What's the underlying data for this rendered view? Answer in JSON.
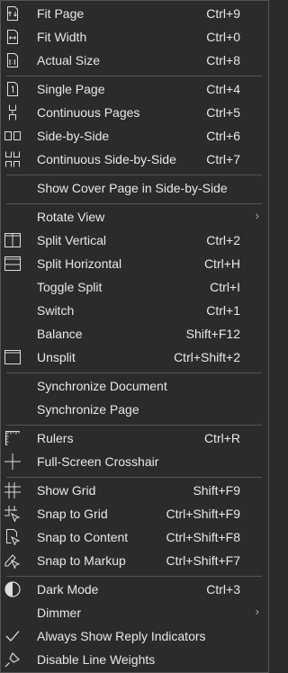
{
  "menu": {
    "fit_page": {
      "label": "Fit Page",
      "shortcut": "Ctrl+9"
    },
    "fit_width": {
      "label": "Fit Width",
      "shortcut": "Ctrl+0"
    },
    "actual_size": {
      "label": "Actual Size",
      "shortcut": "Ctrl+8"
    },
    "single_page": {
      "label": "Single Page",
      "shortcut": "Ctrl+4"
    },
    "continuous_pages": {
      "label": "Continuous Pages",
      "shortcut": "Ctrl+5"
    },
    "side_by_side": {
      "label": "Side-by-Side",
      "shortcut": "Ctrl+6"
    },
    "continuous_side_by_side": {
      "label": "Continuous Side-by-Side",
      "shortcut": "Ctrl+7"
    },
    "show_cover_page": {
      "label": "Show Cover Page in Side-by-Side"
    },
    "rotate_view": {
      "label": "Rotate View"
    },
    "split_vertical": {
      "label": "Split Vertical",
      "shortcut": "Ctrl+2"
    },
    "split_horizontal": {
      "label": "Split Horizontal",
      "shortcut": "Ctrl+H"
    },
    "toggle_split": {
      "label": "Toggle Split",
      "shortcut": "Ctrl+I"
    },
    "switch": {
      "label": "Switch",
      "shortcut": "Ctrl+1"
    },
    "balance": {
      "label": "Balance",
      "shortcut": "Shift+F12"
    },
    "unsplit": {
      "label": "Unsplit",
      "shortcut": "Ctrl+Shift+2"
    },
    "sync_document": {
      "label": "Synchronize Document"
    },
    "sync_page": {
      "label": "Synchronize Page"
    },
    "rulers": {
      "label": "Rulers",
      "shortcut": "Ctrl+R"
    },
    "crosshair": {
      "label": "Full-Screen Crosshair"
    },
    "show_grid": {
      "label": "Show Grid",
      "shortcut": "Shift+F9"
    },
    "snap_grid": {
      "label": "Snap to Grid",
      "shortcut": "Ctrl+Shift+F9"
    },
    "snap_content": {
      "label": "Snap to Content",
      "shortcut": "Ctrl+Shift+F8"
    },
    "snap_markup": {
      "label": "Snap to Markup",
      "shortcut": "Ctrl+Shift+F7"
    },
    "dark_mode": {
      "label": "Dark Mode",
      "shortcut": "Ctrl+3"
    },
    "dimmer": {
      "label": "Dimmer"
    },
    "reply_indicators": {
      "label": "Always Show Reply Indicators"
    },
    "line_weights": {
      "label": "Disable Line Weights"
    }
  },
  "colors": {
    "background": "#2b2b2b",
    "text": "#e8e8e8",
    "separator": "#555555"
  }
}
